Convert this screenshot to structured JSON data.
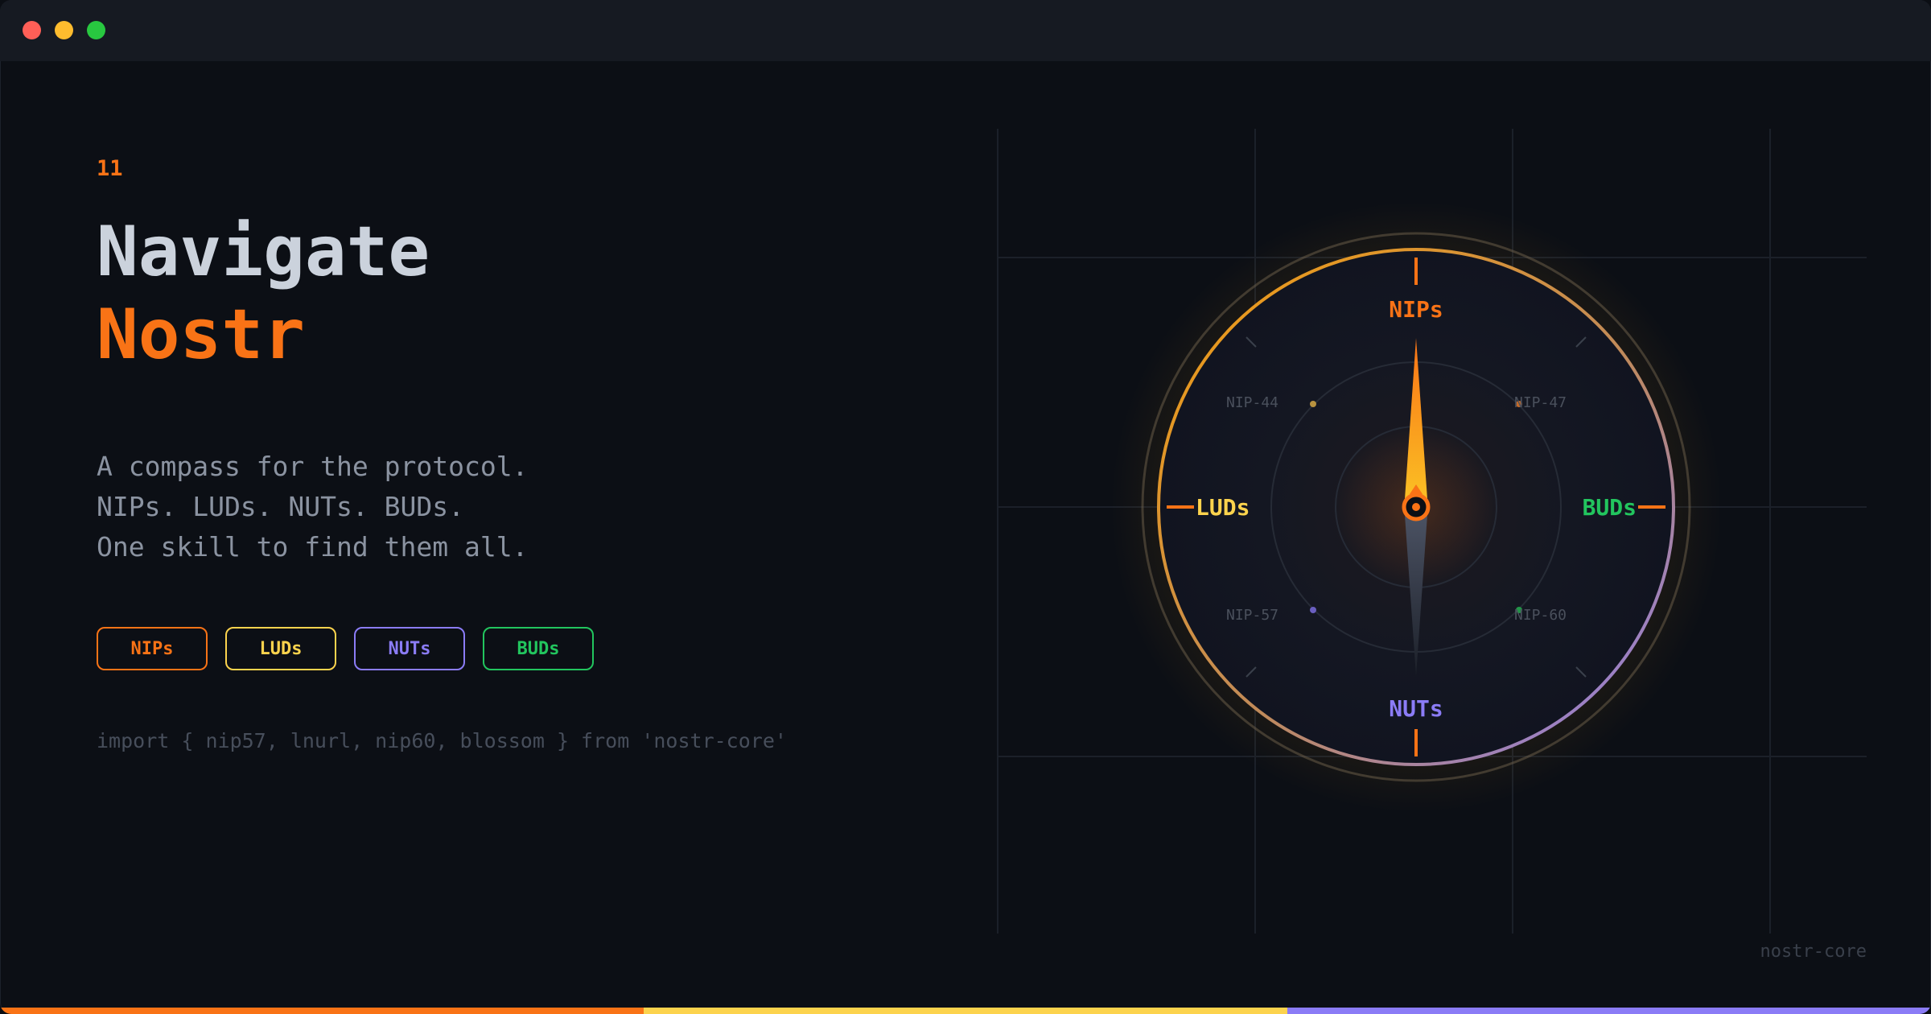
{
  "window": {
    "controls": [
      "close",
      "minimize",
      "maximize"
    ]
  },
  "slide": {
    "number": "11",
    "title_line1": "Navigate",
    "title_line2": "Nostr",
    "description": "A compass for the protocol.\nNIPs. LUDs. NUTs. BUDs.\nOne skill to find them all.",
    "tags": [
      {
        "label": "NIPs",
        "color": "#f97316"
      },
      {
        "label": "LUDs",
        "color": "#fcd34d"
      },
      {
        "label": "NUTs",
        "color": "#8b7cf6"
      },
      {
        "label": "BUDs",
        "color": "#22c55e"
      }
    ],
    "code": "import { nip57, lnurl, nip60, blossom } from 'nostr-core'",
    "brand": "nostr-core"
  },
  "compass": {
    "north": {
      "label": "NIPs",
      "color": "#f97316"
    },
    "west": {
      "label": "LUDs",
      "color": "#fcd34d"
    },
    "east": {
      "label": "BUDs",
      "color": "#22c55e"
    },
    "south": {
      "label": "NUTs",
      "color": "#8b7cf6"
    },
    "nw": {
      "label": "NIP-44"
    },
    "ne": {
      "label": "NIP-47"
    },
    "sw": {
      "label": "NIP-57"
    },
    "se": {
      "label": "NIP-60"
    }
  },
  "theme": {
    "accent": "#f97316",
    "gold": "#fcd34d",
    "purple": "#8b7cf6",
    "green": "#22c55e",
    "background": "#0c0f15"
  }
}
